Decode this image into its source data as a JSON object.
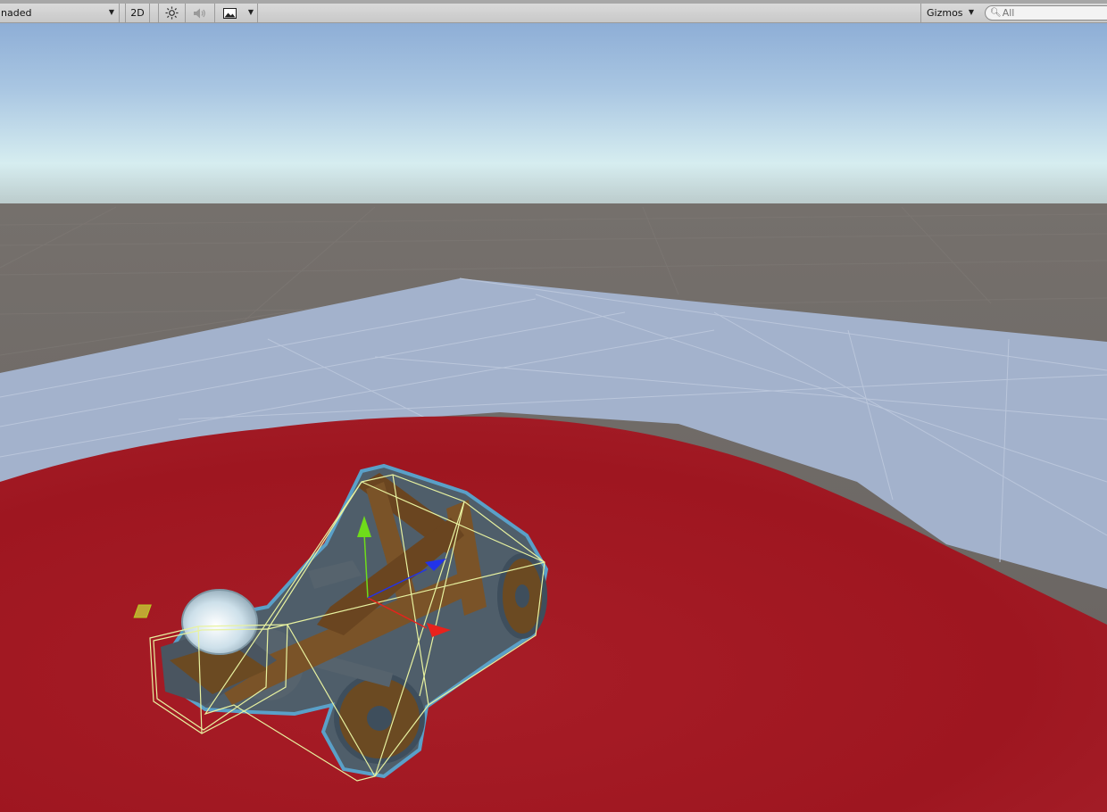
{
  "toolbar": {
    "shading_mode": "naded",
    "btn_2d": "2D",
    "gizmos_label": "Gizmos",
    "search_placeholder": "All",
    "icons": {
      "dropdown": "caret-down-icon",
      "lighting": "sun-icon",
      "audio": "speaker-icon",
      "effects": "image-icon",
      "search": "magnifier-icon"
    }
  },
  "scene": {
    "sky_color": "#9fbad8",
    "ground_color": "#6b6663",
    "platform_color": "#a4b3ce",
    "disc_color": "#a51c26",
    "selection_outline": "#5aa0c8",
    "bounds_color": "#e8f2a0",
    "gizmo_axes": {
      "x": "#e8221c",
      "y": "#6fdc1a",
      "z": "#2233e8"
    }
  }
}
